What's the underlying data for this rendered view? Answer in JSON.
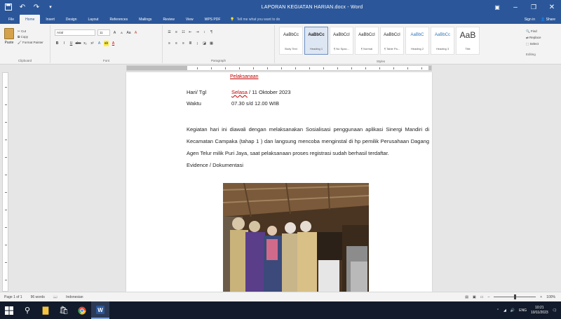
{
  "window": {
    "title": "LAPORAN KEGIATAN HARIAN.docx - Word",
    "controls": [
      "minimize",
      "restore",
      "close"
    ]
  },
  "quick_access": [
    "save-icon",
    "undo-icon",
    "redo-icon"
  ],
  "ribbon_tabs": [
    "File",
    "Home",
    "Insert",
    "Design",
    "Layout",
    "References",
    "Mailings",
    "Review",
    "View",
    "WPS PDF"
  ],
  "tell_me": "Tell me what you want to do",
  "account": {
    "sign_in": "Sign in",
    "share": "Share"
  },
  "ribbon": {
    "clipboard": {
      "paste": "Paste",
      "cut": "Cut",
      "copy": "Copy",
      "format_painter": "Format Painter",
      "label": "Clipboard"
    },
    "font": {
      "name": "Arial",
      "size": "11",
      "label": "Font"
    },
    "paragraph_label": "Paragraph",
    "styles": [
      {
        "preview": "AaBbCc",
        "name": "Body Text"
      },
      {
        "preview": "AaBbCc",
        "name": "Heading 1"
      },
      {
        "preview": "AaBbCcI",
        "name": "¶ No Spac..."
      },
      {
        "preview": "AaBbCcI",
        "name": "¶ Normal"
      },
      {
        "preview": "AaBbCcI",
        "name": "¶ Table Pa..."
      },
      {
        "preview": "AaBbC",
        "name": "Heading 2"
      },
      {
        "preview": "AaBbCc",
        "name": "Heading 3"
      },
      {
        "preview": "AaB",
        "name": "Title"
      }
    ],
    "styles_label": "Styles",
    "editing": {
      "find": "Find",
      "replace": "Replace",
      "select": "Select",
      "label": "Editing"
    }
  },
  "document": {
    "heading": "Pelaksanaan",
    "day_label": "Hari/ Tgl",
    "day_value_day": "Selasa",
    "day_value_rest": " / 11 Oktober  2023",
    "time_label": "Waktu",
    "time_value": "07.30 s/d 12.00 WIB",
    "paragraph": "Kegiatan hari ini diawali dengan melaksanakan Sosialisasi penggunaan aplikasi Sinergi Mandiri di Kecamatan Campaka (tahap 1 ) dan langsung mencoba menginstal di hp pemilik Perusahaan Dagang Agen Telur milik Puri Jaya, saat pelaksanaan proses registrasi sudah berhasil terdaftar.",
    "evidence_label": "Evidence / Dokumentasi"
  },
  "statusbar": {
    "page": "Page 1 of 1",
    "words": "96 words",
    "language": "Indonesian",
    "zoom": "100%",
    "zoom_level": 0.5
  },
  "taskbar": {
    "time": "10:21",
    "date": "10/11/2023",
    "language": "ENG",
    "icons": [
      "windows-start-icon",
      "search-icon",
      "file-explorer-icon",
      "store-icon",
      "chrome-icon",
      "word-icon"
    ]
  },
  "colors": {
    "word_blue": "#2b579a",
    "taskbar": "#121b2b",
    "heading_red": "#c00000"
  }
}
